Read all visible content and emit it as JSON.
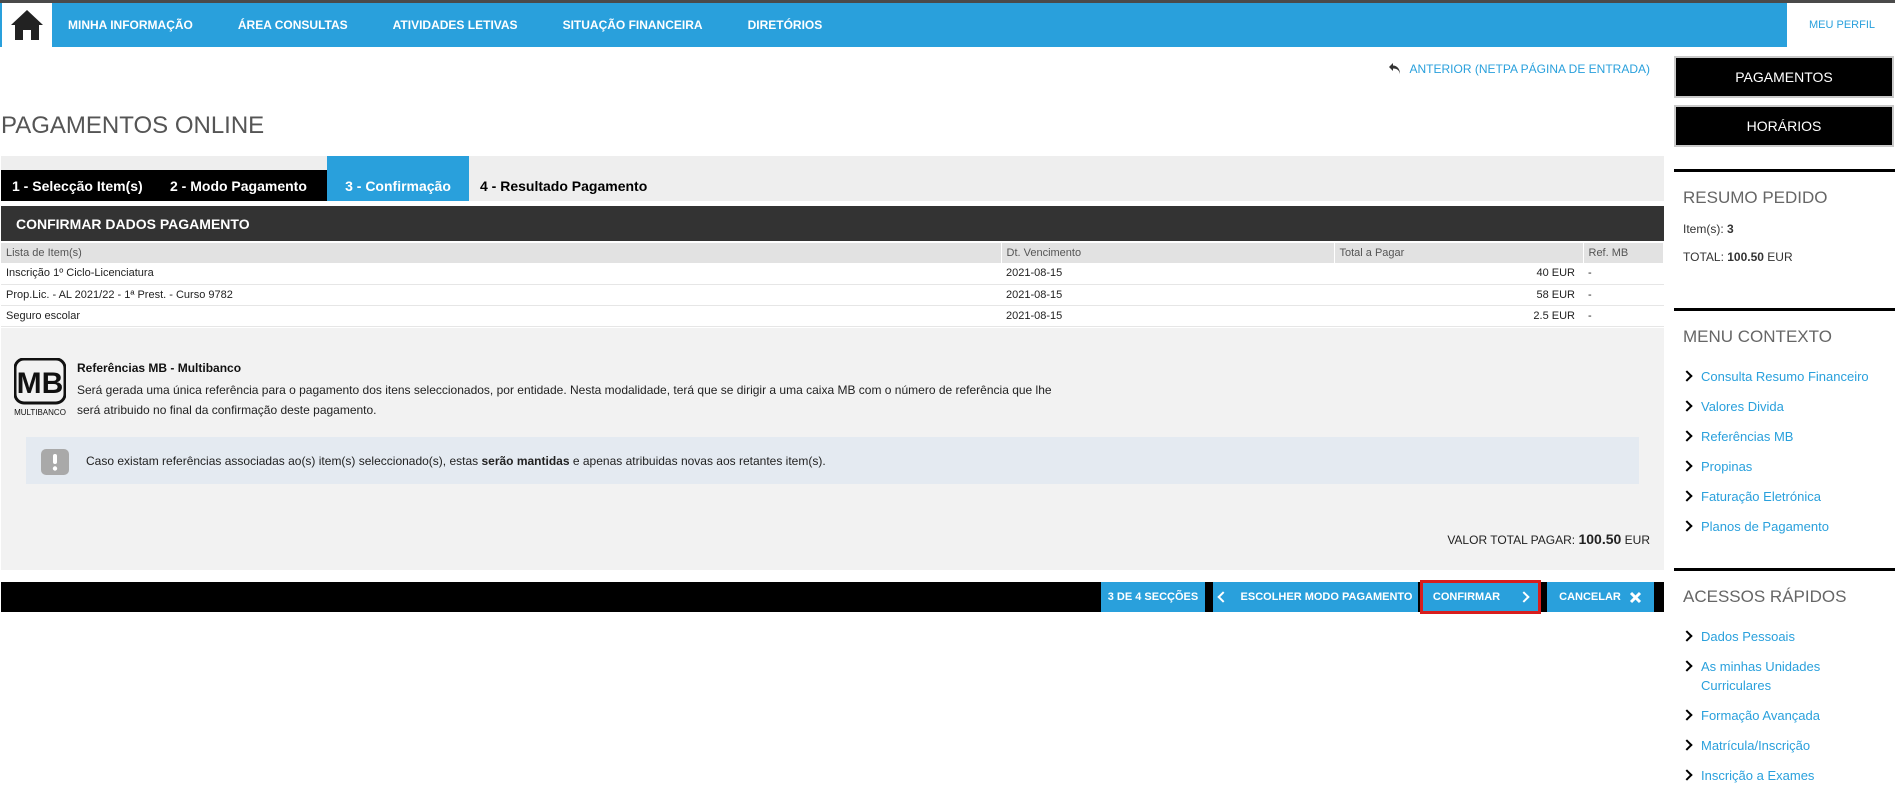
{
  "nav": {
    "items": [
      "MINHA INFORMAÇÃO",
      "ÁREA CONSULTAS",
      "ATIVIDADES LETIVAS",
      "SITUAÇÃO FINANCEIRA",
      "DIRETÓRIOS"
    ],
    "profile": "MEU PERFIL"
  },
  "back_link": "ANTERIOR (NETPA PÁGINA DE ENTRADA)",
  "page_title": "PAGAMENTOS ONLINE",
  "steps": [
    "1 - Selecção Item(s)",
    "2 - Modo Pagamento",
    "3 - Confirmação",
    "4 - Resultado Pagamento"
  ],
  "section_title": "CONFIRMAR DADOS PAGAMENTO",
  "table": {
    "headers": [
      "Lista de Item(s)",
      "Dt. Vencimento",
      "Total a Pagar",
      "Ref. MB"
    ],
    "rows": [
      [
        "Inscrição 1º Ciclo-Licenciatura",
        "2021-08-15",
        "40 EUR",
        "-"
      ],
      [
        "Prop.Lic. - AL 2021/22 - 1ª Prest. - Curso 9782",
        "2021-08-15",
        "58 EUR",
        "-"
      ],
      [
        "Seguro escolar",
        "2021-08-15",
        "2.5 EUR",
        "-"
      ]
    ]
  },
  "mb": {
    "logo_text": "MB",
    "logo_sub": "MULTIBANCO",
    "title": "Referências MB - Multibanco",
    "text": "Será gerada uma única referência para o pagamento dos itens seleccionados, por entidade. Nesta modalidade, terá que se dirigir a uma caixa MB com o número de referência que lhe será atribuido no final da confirmação deste pagamento."
  },
  "info": {
    "before": "Caso existam referências associadas ao(s) item(s) seleccionado(s), estas ",
    "bold": "serão mantidas",
    "after": " e apenas atribuidas novas aos retantes item(s)."
  },
  "total": {
    "label": "VALOR TOTAL PAGAR:",
    "value": "100.50",
    "currency": "EUR"
  },
  "actions": {
    "sections": "3 DE 4 SECÇÕES",
    "back": "ESCOLHER MODO PAGAMENTO",
    "confirm": "CONFIRMAR",
    "cancel": "CANCELAR"
  },
  "sidebar": {
    "buttons": [
      "PAGAMENTOS",
      "HORÁRIOS"
    ],
    "summary": {
      "title": "RESUMO PEDIDO",
      "items_label": "Item(s):",
      "items_value": "3",
      "total_label": "TOTAL:",
      "total_value": "100.50",
      "total_currency": "EUR"
    },
    "context_title": "MENU CONTEXTO",
    "context_links": [
      "Consulta Resumo Financeiro",
      "Valores Divida",
      "Referências MB",
      "Propinas",
      "Faturação Eletrónica",
      "Planos de Pagamento"
    ],
    "quick_title": "ACESSOS RÁPIDOS",
    "quick_links": [
      "Dados Pessoais",
      "As minhas Unidades Curriculares",
      "Formação Avançada",
      "Matrícula/Inscrição",
      "Inscrição a Exames"
    ]
  },
  "colors": {
    "accent": "#29a0dc",
    "dark": "#333333",
    "black": "#000000",
    "highlight": "#d81e1e"
  }
}
